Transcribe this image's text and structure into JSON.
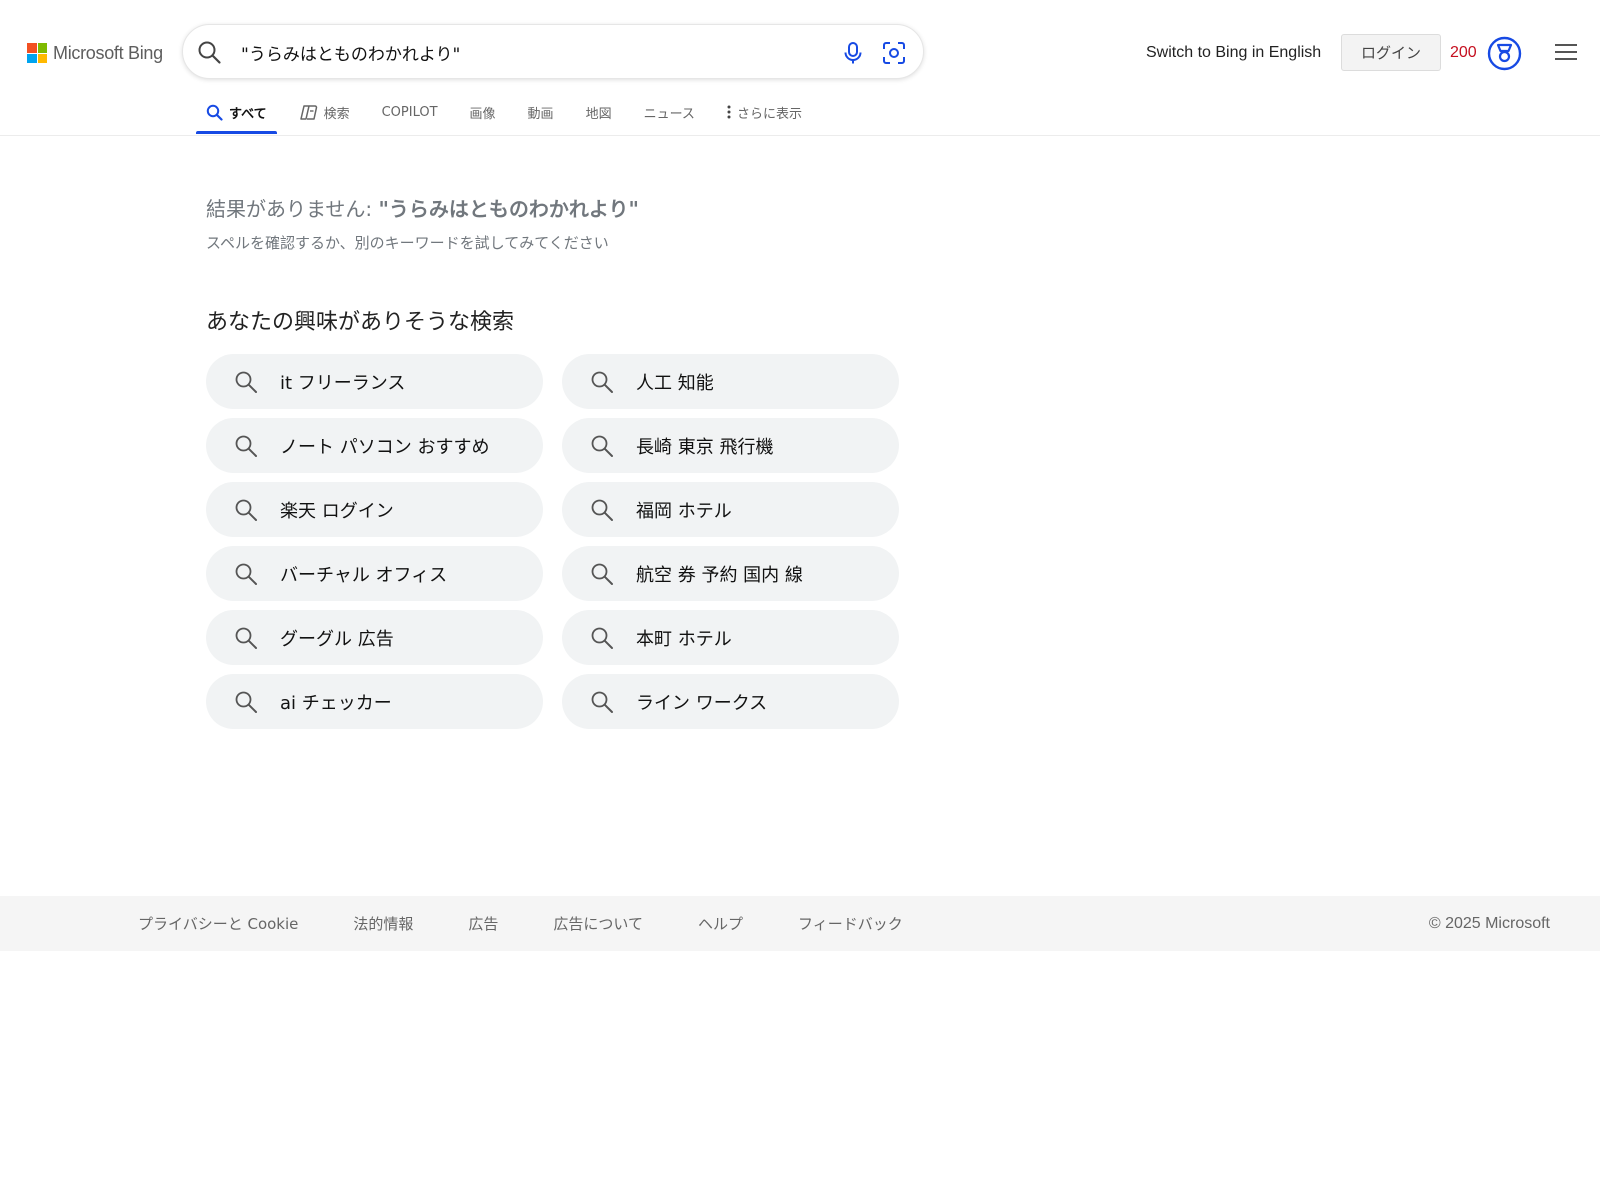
{
  "header": {
    "logo_text": "Microsoft Bing",
    "logo_colors": [
      "#f25022",
      "#7fba00",
      "#00a4ef",
      "#ffb900"
    ],
    "search": {
      "value": "\"うらみはとものわかれより\"",
      "search_icon": "search-icon",
      "mic_icon": "microphone-icon",
      "visual_search_icon": "visual-search-icon"
    },
    "switch_language": "Switch to Bing in English",
    "login_label": "ログイン",
    "points": "200",
    "rewards_icon": "rewards-medal-icon",
    "menu_icon": "hamburger-menu-icon"
  },
  "tabs": [
    {
      "label": "すべて",
      "icon": "search-icon",
      "active": true
    },
    {
      "label": "検索",
      "icon": "copilot-search-icon",
      "active": false
    },
    {
      "label": "COPILOT",
      "active": false
    },
    {
      "label": "画像",
      "active": false
    },
    {
      "label": "動画",
      "active": false
    },
    {
      "label": "地図",
      "active": false
    },
    {
      "label": "ニュース",
      "active": false
    },
    {
      "label": "さらに表示",
      "icon": "more-vertical-icon",
      "active": false
    }
  ],
  "main": {
    "no_results_prefix": "結果がありません: ",
    "no_results_query": "\"うらみはとものわかれより\"",
    "no_results_hint": "スペルを確認するか、別のキーワードを試してみてください",
    "related_title": "あなたの興味がありそうな検索",
    "related_searches": [
      "it フリーランス",
      "人工 知能",
      "ノート パソコン おすすめ",
      "長崎 東京 飛行機",
      "楽天 ログイン",
      "福岡 ホテル",
      "バーチャル オフィス",
      "航空 券 予約 国内 線",
      "グーグル 広告",
      "本町 ホテル",
      "ai チェッカー",
      "ライン ワークス"
    ]
  },
  "footer": {
    "links": [
      "プライバシーと Cookie",
      "法的情報",
      "広告",
      "広告について",
      "ヘルプ",
      "フィードバック"
    ],
    "copyright": "© 2025 Microsoft"
  },
  "colors": {
    "accent": "#174ae4",
    "points": "#c50f1f",
    "pill_bg": "#f1f3f4",
    "footer_bg": "#f5f5f5"
  }
}
